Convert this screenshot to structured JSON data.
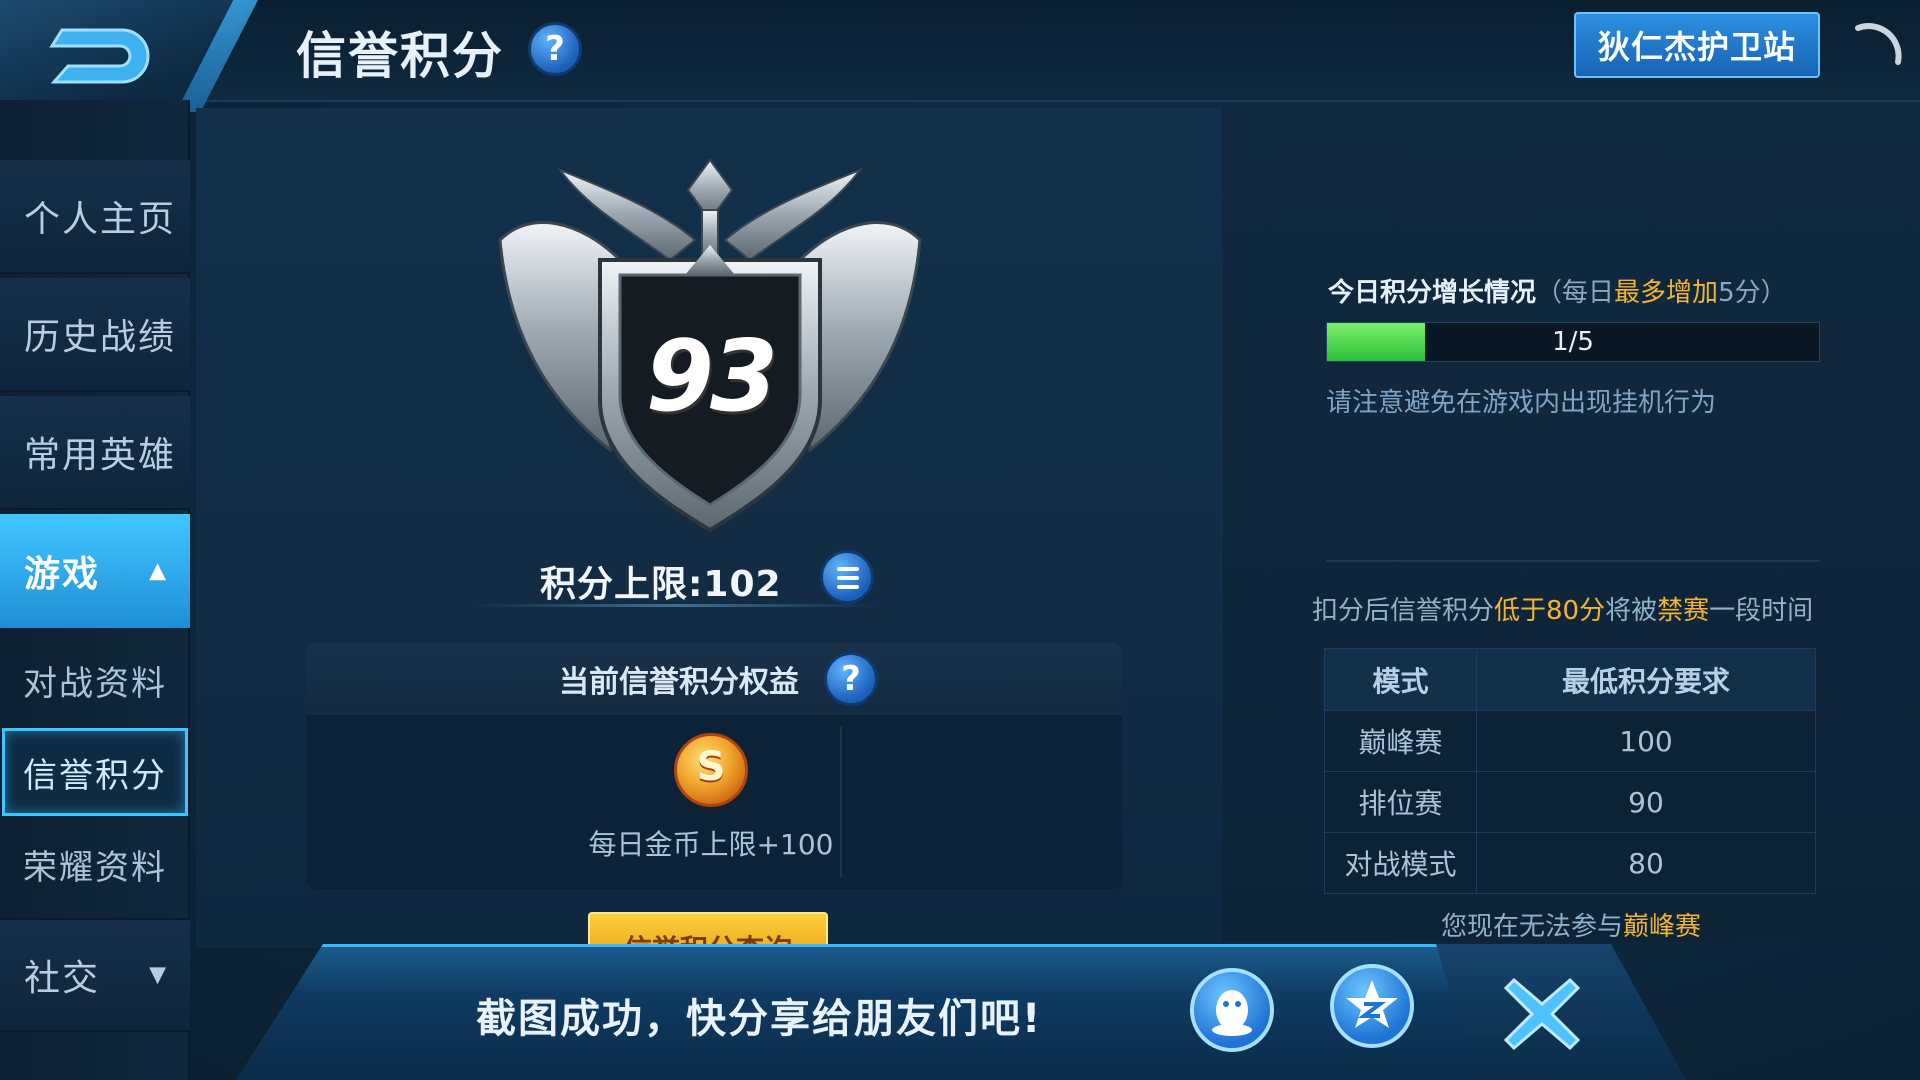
{
  "header": {
    "title": "信誉积分",
    "guard_button": "狄仁杰护卫站"
  },
  "sidebar": {
    "items": [
      {
        "label": "个人主页"
      },
      {
        "label": "历史战绩"
      },
      {
        "label": "常用英雄"
      },
      {
        "label": "游戏"
      },
      {
        "label": "对战资料"
      },
      {
        "label": "信誉积分"
      },
      {
        "label": "荣耀资料"
      },
      {
        "label": "社交"
      }
    ],
    "expanded": "游戏",
    "selected": "信誉积分"
  },
  "score": {
    "value": "93",
    "limit_label": "积分上限:102"
  },
  "benefits": {
    "header": "当前信誉积分权益",
    "items": [
      {
        "icon": "gold-coin-icon",
        "text": "每日金币上限+100"
      }
    ],
    "query_button": "信誉积分查询"
  },
  "today": {
    "title": "今日积分增长情况",
    "paren_open": "（",
    "paren_mid": "每日",
    "paren_hl": "最多增加",
    "paren_tail": "5分",
    "paren_close": "）",
    "progress_text": "1/5",
    "progress_value": 0.2,
    "warning": "请注意避免在游戏内出现挂机行为"
  },
  "deduct": {
    "pre": "扣分后信誉积分",
    "hl1": "低于80分",
    "mid": "将被",
    "hl2": "禁赛",
    "post": "一段时间"
  },
  "mode_table": {
    "headers": [
      "模式",
      "最低积分要求"
    ],
    "rows": [
      [
        "巅峰赛",
        "100"
      ],
      [
        "排位赛",
        "90"
      ],
      [
        "对战模式",
        "80"
      ]
    ]
  },
  "notice": {
    "pre": "您现在无法参与",
    "hl": "巅峰赛"
  },
  "share": {
    "text": "截图成功，快分享给朋友们吧!",
    "buttons": [
      "qq-icon",
      "qzone-icon",
      "close-icon"
    ]
  },
  "colors": {
    "accent": "#3ec4ff",
    "highlight": "#f3b431",
    "progress": "#2ec03a"
  }
}
